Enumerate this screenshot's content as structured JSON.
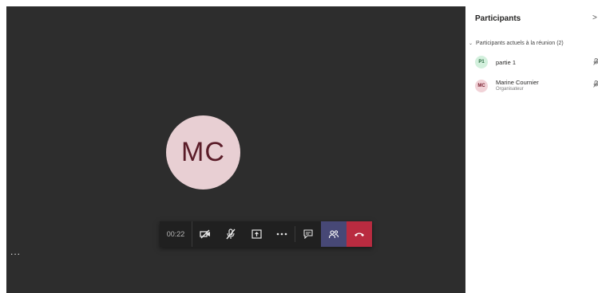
{
  "stage": {
    "avatar_initials": "MC",
    "more_label": "..."
  },
  "callbar": {
    "timer": "00:22",
    "buttons": [
      {
        "name": "camera-off",
        "icon": "video-off-icon"
      },
      {
        "name": "mic-off",
        "icon": "mic-off-icon"
      },
      {
        "name": "share-screen",
        "icon": "share-screen-icon"
      },
      {
        "name": "more-actions",
        "icon": "more-icon"
      },
      {
        "name": "chat",
        "icon": "chat-icon"
      },
      {
        "name": "participants",
        "icon": "people-icon"
      },
      {
        "name": "hang-up",
        "icon": "phone-hangup-icon"
      }
    ],
    "colors": {
      "bar": "#202020",
      "active": "#474876",
      "hangup": "#b92b40"
    }
  },
  "panel": {
    "title": "Participants",
    "close": ">",
    "section_label": "Participants actuels à la réunion (2)",
    "participants": [
      {
        "initials": "P1",
        "name": "partie 1",
        "role": "",
        "avatar_bg": "#d3f0dd",
        "avatar_fg": "#2a6a40"
      },
      {
        "initials": "MC",
        "name": "Marine Cournier",
        "role": "Organisateur",
        "avatar_bg": "#f1d3d8",
        "avatar_fg": "#7a2030"
      }
    ]
  }
}
